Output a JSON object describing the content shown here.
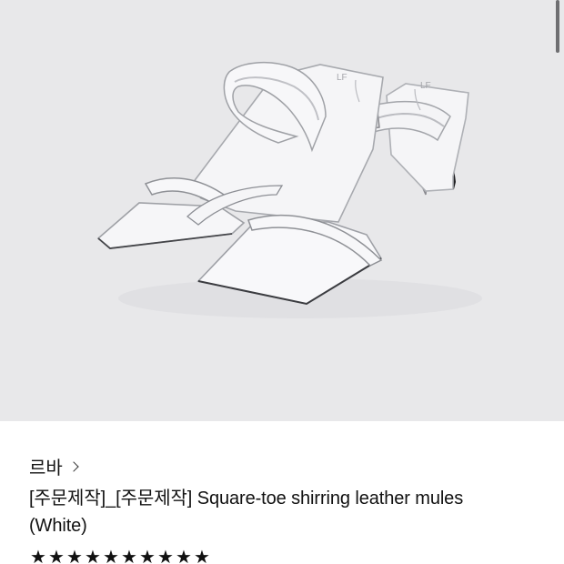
{
  "product": {
    "brand": "르바",
    "title": "[주문제작]_[주문제작] Square-toe shirring leather mules (White)",
    "rating_stars": [
      "★",
      "★",
      "★",
      "★",
      "★",
      "★",
      "★",
      "★",
      "★",
      "★"
    ]
  },
  "colors": {
    "image_bg": "#e8e8ea",
    "text": "#111111",
    "scrollbar": "#6f6f72"
  },
  "icons": {
    "brand": "chevron-right-icon"
  }
}
